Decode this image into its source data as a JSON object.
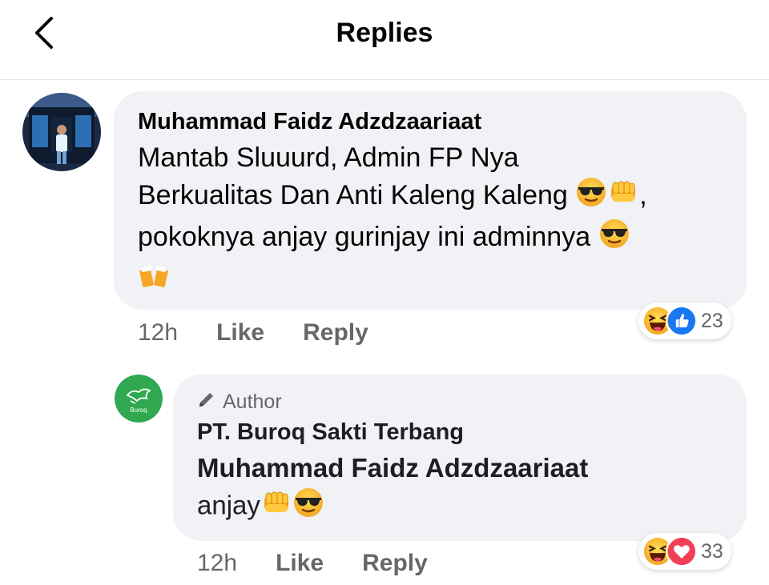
{
  "header": {
    "title": "Replies",
    "back_icon": "chevron-left-icon"
  },
  "comment": {
    "author": "Muhammad Faidz Adzdzaariaat",
    "line1": "Mantab Sluuurd, Admin FP Nya",
    "line2": "Berkualitas Dan Anti Kaleng Kaleng",
    "line2_end": ",",
    "line3": "pokoknya anjay gurinjay ini adminnya",
    "emojis": [
      "sunglasses-emoji",
      "fist-emoji",
      "beer-mugs-emoji"
    ],
    "time": "12h",
    "like_label": "Like",
    "reply_label": "Reply",
    "reactions": [
      "haha",
      "like"
    ],
    "reaction_count": "23"
  },
  "reply": {
    "badge": "Author",
    "page_name": "PT. Buroq Sakti Terbang",
    "avatar_text": "Buroq",
    "mention": "Muhammad Faidz Adzdzaariaat",
    "text": "anjay",
    "time": "12h",
    "like_label": "Like",
    "reply_label": "Reply",
    "reactions": [
      "haha",
      "love"
    ],
    "reaction_count": "33"
  },
  "colors": {
    "bubble": "#f0f2f5",
    "secondary_text": "#65676b",
    "like_blue": "#1877f2",
    "love_red": "#f33e58",
    "haha_yellow": "#f7b928",
    "page_green": "#2fa84f"
  }
}
